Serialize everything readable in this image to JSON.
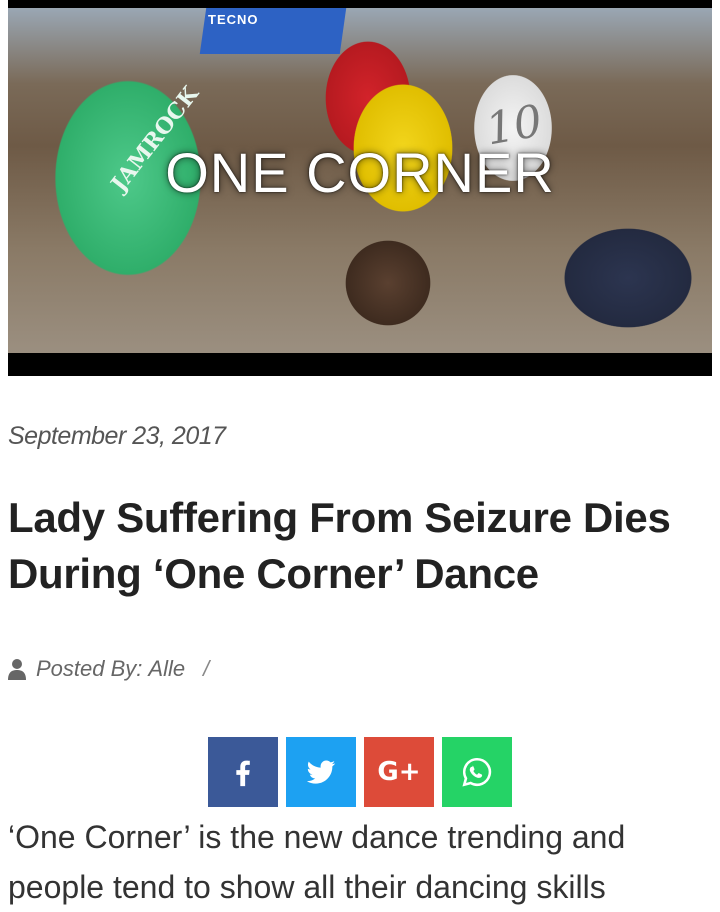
{
  "hero": {
    "overlay_title": "ONE CORNER",
    "canopy_text": "TECNO",
    "jersey_number": "10",
    "shirt_text": "JAMROCK"
  },
  "article": {
    "date": "September 23, 2017",
    "title": "Lady Suffering From Seizure Dies During ‘One Corner’ Dance",
    "byline_prefix": "Posted By:",
    "author": "Alle",
    "byline_separator": "/",
    "body_line_1": "‘One Corner’ is the new dance trending and",
    "body_line_2": "people tend to show all their dancing skills"
  },
  "share": {
    "buttons": [
      {
        "network": "facebook",
        "icon": "facebook-icon",
        "color": "#3b5998"
      },
      {
        "network": "twitter",
        "icon": "twitter-icon",
        "color": "#1da1f2"
      },
      {
        "network": "google-plus",
        "icon": "google-plus-icon",
        "color": "#dd4b39",
        "label": "G+"
      },
      {
        "network": "whatsapp",
        "icon": "whatsapp-icon",
        "color": "#25d366"
      }
    ]
  },
  "icons": {
    "author": "user-icon"
  }
}
